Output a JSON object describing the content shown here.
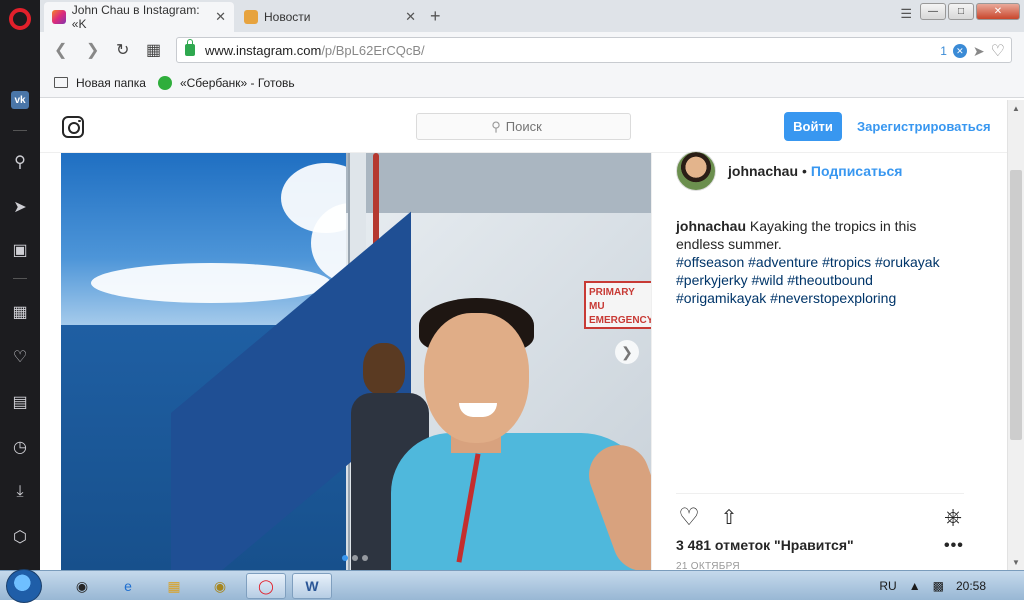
{
  "browser": {
    "tabs": [
      {
        "title": "John Chau в Instagram: «K",
        "active": true
      },
      {
        "title": "Новости",
        "active": false
      }
    ],
    "url": {
      "host": "www.instagram.com",
      "path": "/p/BpL62ErCQcB/"
    },
    "adblock_count": "1",
    "bookmarks": [
      {
        "label": "Новая папка",
        "icon": "folder-icon"
      },
      {
        "label": "«Сбербанк» - Готовь",
        "icon": "sberbank-icon"
      }
    ]
  },
  "instagram": {
    "search_placeholder": "Поиск",
    "login_label": "Войти",
    "signup_label": "Зарегистрироваться"
  },
  "post": {
    "author": "johnachau",
    "follow_label": "Подписаться",
    "follow_separator": "•",
    "caption_user": "johnachau",
    "caption_text": "Kayaking the tropics in this endless summer.",
    "hashtags": "#offseason #adventure #tropics #orukayak #perkyjerky #wild #theoutbound #origamikayak #neverstopexploring",
    "sign_text": "PRIMARY MU EMERGENCY",
    "likes": "3 481 отметок \"Нравится\"",
    "more_label": "•••",
    "date": "21 октября",
    "carousel_dots": 3,
    "carousel_active": 1
  },
  "taskbar": {
    "language": "RU",
    "time": "20:58"
  }
}
